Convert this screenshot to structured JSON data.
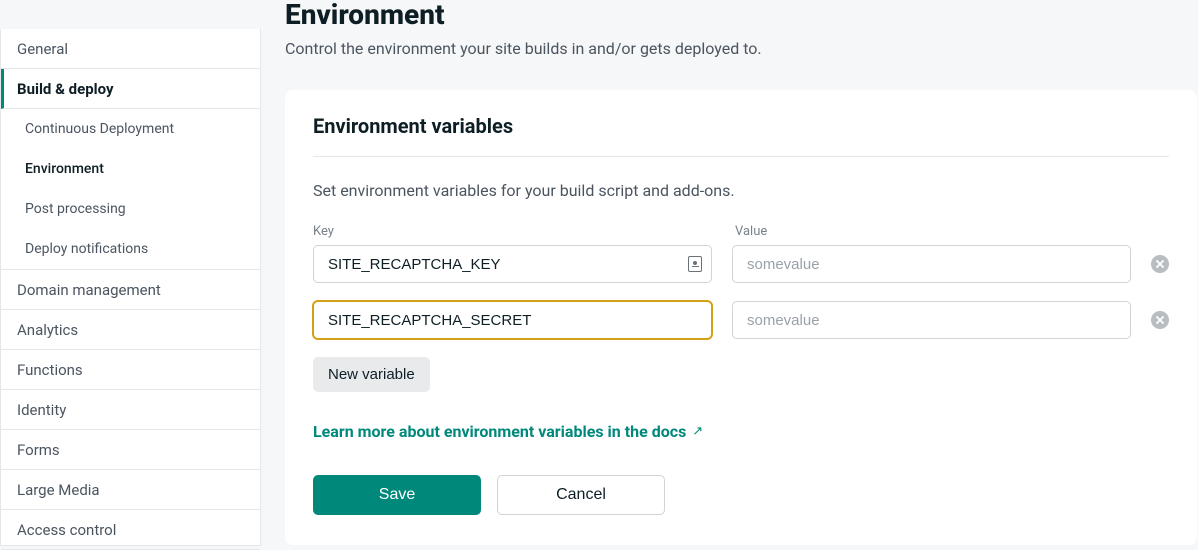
{
  "sidebar": {
    "items": [
      {
        "label": "General"
      },
      {
        "label": "Build & deploy",
        "active": true,
        "children": [
          {
            "label": "Continuous Deployment"
          },
          {
            "label": "Environment",
            "current": true
          },
          {
            "label": "Post processing"
          },
          {
            "label": "Deploy notifications"
          }
        ]
      },
      {
        "label": "Domain management"
      },
      {
        "label": "Analytics"
      },
      {
        "label": "Functions"
      },
      {
        "label": "Identity"
      },
      {
        "label": "Forms"
      },
      {
        "label": "Large Media"
      },
      {
        "label": "Access control"
      }
    ]
  },
  "page": {
    "title": "Environment",
    "subtitle": "Control the environment your site builds in and/or gets deployed to."
  },
  "card": {
    "title": "Environment variables",
    "description": "Set environment variables for your build script and add-ons.",
    "key_label": "Key",
    "value_label": "Value",
    "rows": [
      {
        "key": "SITE_RECAPTCHA_KEY",
        "value_placeholder": "somevalue"
      },
      {
        "key": "SITE_RECAPTCHA_SECRET",
        "value_placeholder": "somevalue"
      }
    ],
    "new_variable": "New variable",
    "learn_more": "Learn more about environment variables in the docs",
    "save": "Save",
    "cancel": "Cancel"
  }
}
